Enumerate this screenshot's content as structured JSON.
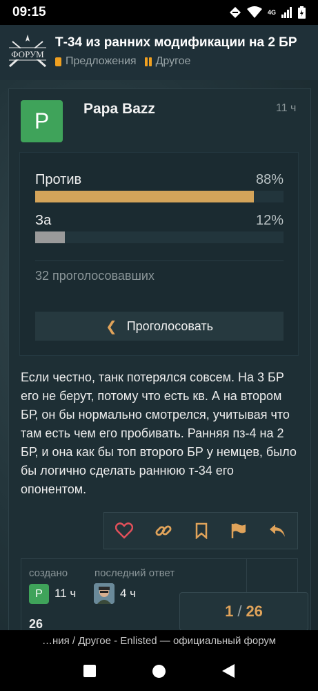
{
  "status": {
    "time": "09:15",
    "network": "4G"
  },
  "header": {
    "logo_text": "ФОРУМ",
    "title": "Т-34 из ранних модификации на 2 БР",
    "categories": [
      "Предложения",
      "Другое"
    ]
  },
  "post": {
    "avatar_letter": "P",
    "username": "Papa Bazz",
    "time": "11 ч",
    "poll": {
      "options": [
        {
          "label": "Против",
          "percent_text": "88%",
          "percent": 88,
          "color": "#d4a45a"
        },
        {
          "label": "За",
          "percent_text": "12%",
          "percent": 12,
          "color": "#9a9a9a"
        }
      ],
      "voters": "32 проголосовавших",
      "vote_button": "Проголосовать"
    },
    "text": "Если честно, танк потерялся совсем. На 3 БР его не берут, потому что есть кв. А на втором БР, он бы нормально смотрелся, учитывая что там есть чем его пробивать. Ранняя пз-4 на 2 БР, и она как бы топ второго БР у немцев, было бы логично сделать раннюю т-34 его опонентом."
  },
  "topic_map": {
    "created_label": "создано",
    "created_avatar": "P",
    "created_time": "11 ч",
    "last_reply_label": "последний ответ",
    "last_reply_time": "4 ч",
    "replies": "26"
  },
  "progress": {
    "current": "1",
    "total": "26"
  },
  "footer": {
    "url_text": "…ния / Другое - Enlisted — официальный форум"
  },
  "colors": {
    "accent": "#e0a35a",
    "like": "#e0505a"
  }
}
